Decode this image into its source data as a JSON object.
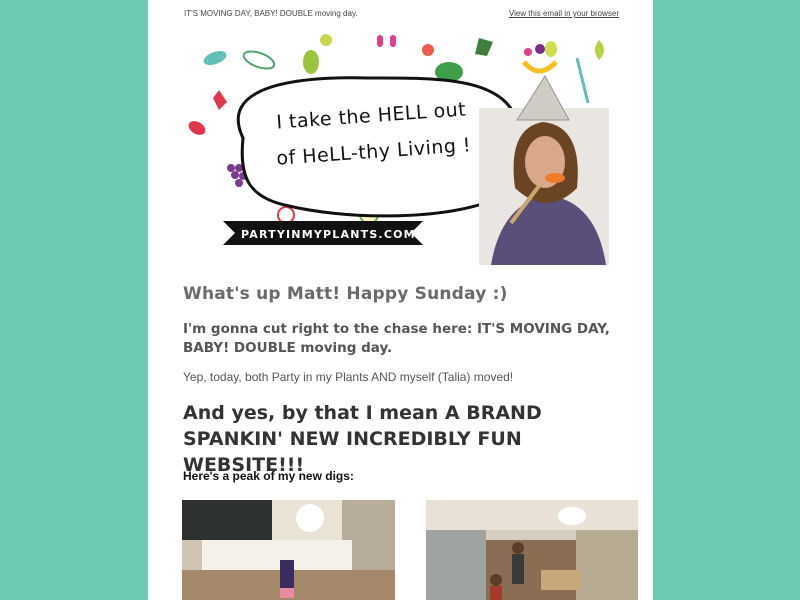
{
  "preheader": {
    "subject": "IT'S MOVING DAY, BABY! DOUBLE moving day.",
    "view_in_browser": "View this email in your browser"
  },
  "hero": {
    "bubble_line1": "I take the HELL out",
    "bubble_line2": "of HeLL-thy Living !",
    "banner": "PARTYINMYPLANTS.COM"
  },
  "body": {
    "greeting": "What's up Matt! Happy Sunday :)",
    "chase": "I'm gonna cut right to the chase here: IT'S MOVING DAY, BABY! DOUBLE moving day.",
    "moved": "Yep, today, both Party in my Plants AND myself (Talia) moved!",
    "website": "And yes, by that I mean A BRAND SPANKIN' NEW INCREDIBLY FUN WEBSITE!!!",
    "peak": "Here's a peak of my new digs:"
  },
  "colors": {
    "background": "#6ecab4",
    "email": "#ffffff",
    "heading": "#6a6a6a",
    "banner": "#111111"
  }
}
